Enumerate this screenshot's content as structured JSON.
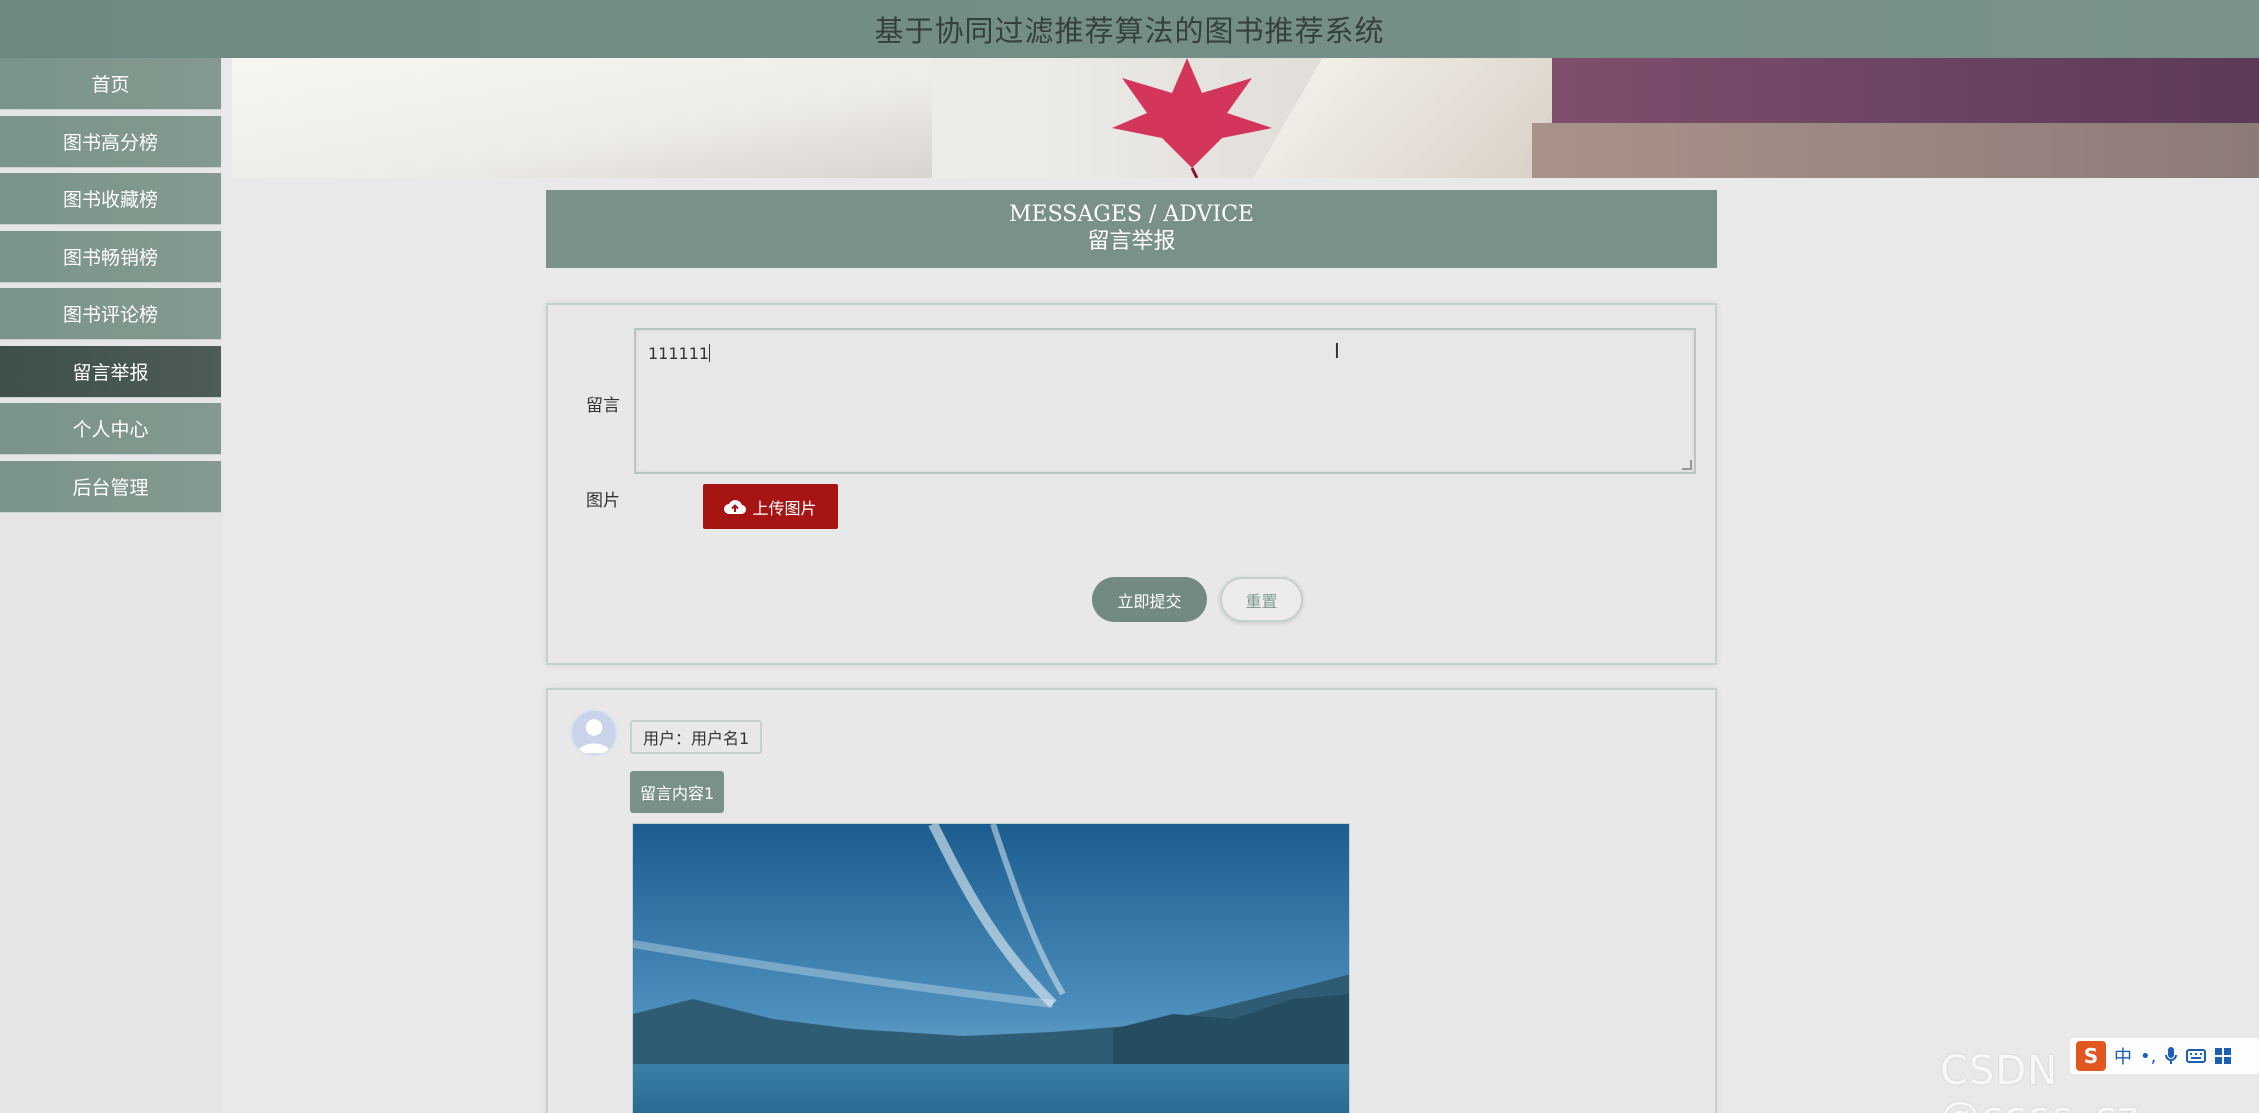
{
  "header": {
    "title": "基于协同过滤推荐算法的图书推荐系统"
  },
  "sidebar": {
    "items": [
      {
        "label": "首页"
      },
      {
        "label": "图书高分榜"
      },
      {
        "label": "图书收藏榜"
      },
      {
        "label": "图书畅销榜"
      },
      {
        "label": "图书评论榜"
      },
      {
        "label": "留言举报",
        "active": true
      },
      {
        "label": "个人中心"
      },
      {
        "label": "后台管理"
      }
    ]
  },
  "section": {
    "title_en": "MESSAGES / ADVICE",
    "title_zh": "留言举报"
  },
  "form": {
    "message_label": "留言",
    "message_value": "111111",
    "image_label": "图片",
    "upload_label": "上传图片",
    "submit_label": "立即提交",
    "reset_label": "重置"
  },
  "messages": [
    {
      "user": "用户：用户名1",
      "content": "留言内容1"
    }
  ],
  "overlay": {
    "watermark": "CSDN @cccc_cz",
    "ime_mode": "中",
    "ime_punct": "•,"
  },
  "colors": {
    "accent": "#7a9188",
    "active_nav": "#3f5049",
    "upload": "#a71414"
  },
  "icons": [
    "upload-cloud-icon",
    "user-avatar-icon",
    "text-cursor-icon",
    "microphone-icon",
    "keyboard-icon",
    "grid-icon"
  ]
}
